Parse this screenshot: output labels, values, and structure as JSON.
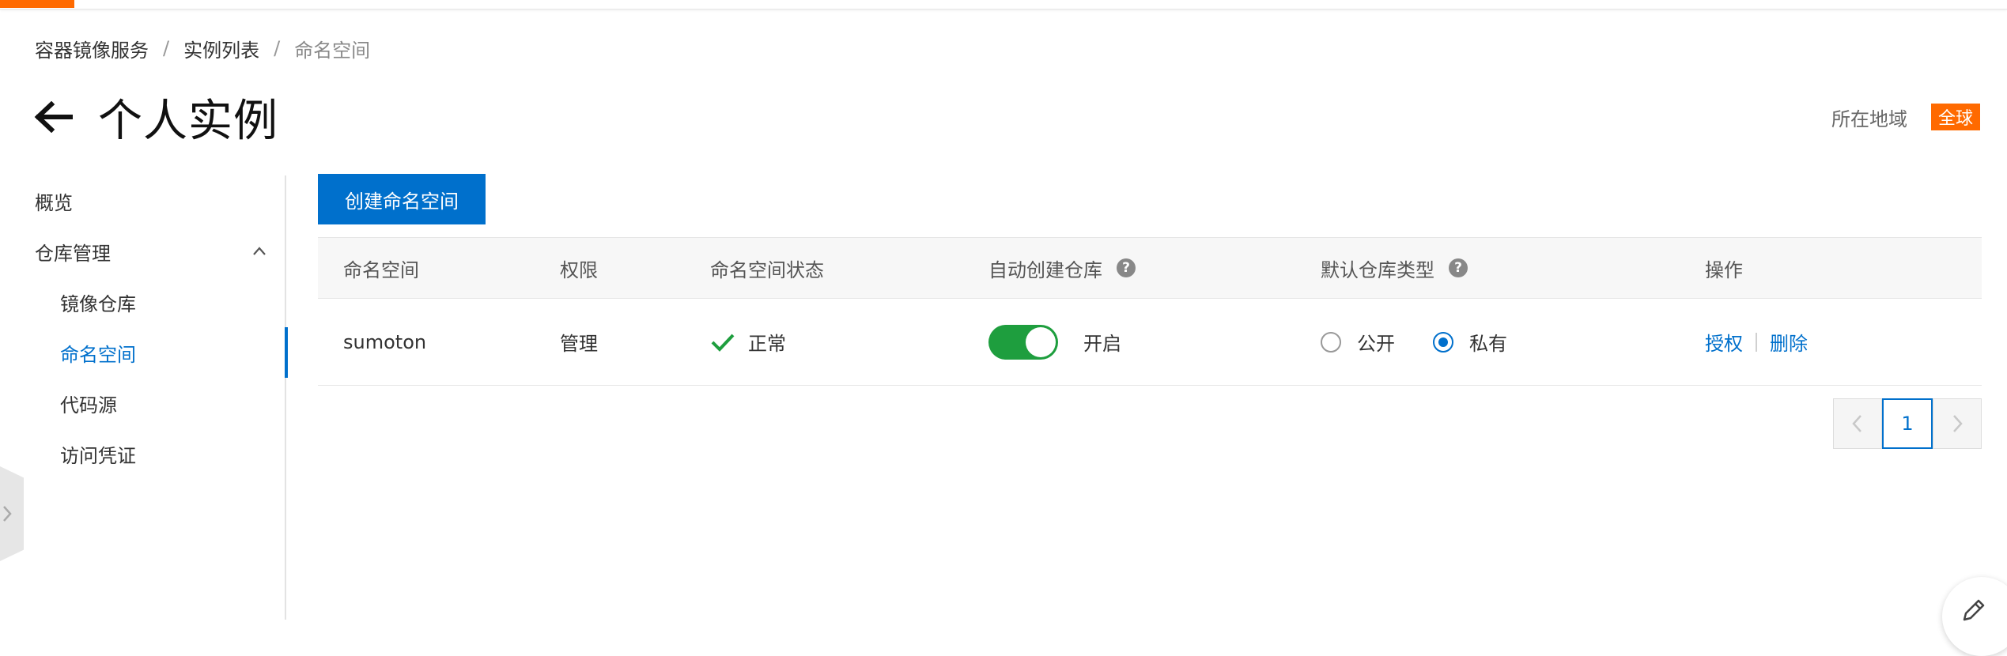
{
  "breadcrumb": {
    "items": [
      "容器镜像服务",
      "实例列表",
      "命名空间"
    ],
    "separator": "/"
  },
  "page": {
    "title": "个人实例",
    "region_label": "所在地域",
    "region_value": "全球"
  },
  "sidebar": {
    "overview": "概览",
    "repo_group": "仓库管理",
    "items": [
      "镜像仓库",
      "命名空间",
      "代码源",
      "访问凭证"
    ],
    "active": "命名空间"
  },
  "toolbar": {
    "create_label": "创建命名空间"
  },
  "table": {
    "headers": {
      "namespace": "命名空间",
      "permission": "权限",
      "status": "命名空间状态",
      "auto_create": "自动创建仓库",
      "default_type": "默认仓库类型",
      "actions": "操作"
    },
    "help_glyph": "?",
    "rows": [
      {
        "namespace": "sumoton",
        "permission": "管理",
        "status": "正常",
        "auto_create_label": "开启",
        "auto_create_on": true,
        "type_public": "公开",
        "type_private": "私有",
        "selected_type": "私有",
        "action_grant": "授权",
        "action_delete": "删除"
      }
    ]
  },
  "pagination": {
    "current": "1"
  },
  "colors": {
    "accent": "#ff6a00",
    "primary": "#0070cc",
    "success": "#1e9e3e"
  },
  "icons": [
    "back-arrow-icon",
    "chevron-up-icon",
    "help-icon",
    "check-icon",
    "chevron-left-icon",
    "chevron-right-icon",
    "edit-icon",
    "expand-sidebar-icon"
  ]
}
